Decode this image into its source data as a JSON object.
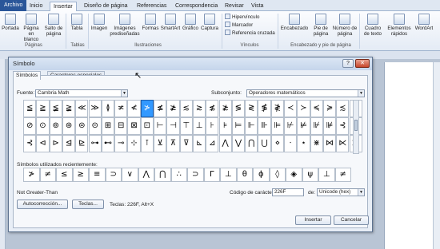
{
  "ribbon": {
    "tabs": [
      "Archivo",
      "Inicio",
      "Insertar",
      "Diseño de página",
      "Referencias",
      "Correspondencia",
      "Revisar",
      "Vista"
    ],
    "buttons": {
      "portada": "Portada",
      "pagina_en_blanco": "Página en blanco",
      "salto_de_pagina": "Salto de página",
      "tabla": "Tabla",
      "imagen": "Imagen",
      "imagenes_predisenadas": "Imágenes prediseñadas",
      "formas": "Formas",
      "smartart": "SmartArt",
      "grafico": "Gráfico",
      "captura": "Captura",
      "hipervinculo": "Hipervínculo",
      "marcador": "Marcador",
      "referencia_cruzada": "Referencia cruzada",
      "encabezado": "Encabezado",
      "pie_de_pagina": "Pie de página",
      "numero_de_pagina": "Número de página",
      "cuadro_de_texto": "Cuadro de texto",
      "elementos_rapidos": "Elementos rápidos",
      "wordart": "WordArt"
    },
    "groups": {
      "paginas": "Páginas",
      "tablas": "Tablas",
      "ilustraciones": "Ilustraciones",
      "vinculos": "Vínculos",
      "encabezado": "Encabezado y pie de página"
    }
  },
  "dialog": {
    "title": "Símbolo",
    "tabs": [
      "Símbolos",
      "Caracteres especiales"
    ],
    "font_label": "Fuente:",
    "font_value": "Cambria Math",
    "subset_label": "Subconjunto:",
    "subset_value": "Operadores matemáticos",
    "symbols": [
      [
        "≦",
        "≧",
        "≨",
        "≩",
        "≪",
        "≫",
        "≬",
        "≭",
        "≮",
        "≯",
        "≰",
        "≱",
        "≲",
        "≳",
        "≴",
        "≵",
        "≶",
        "≷",
        "≸",
        "≹",
        "≺",
        "≻",
        "≼",
        "≽",
        "≾",
        "≿"
      ],
      [
        "⊘",
        "⊙",
        "⊚",
        "⊛",
        "⊜",
        "⊝",
        "⊞",
        "⊟",
        "⊠",
        "⊡",
        "⊢",
        "⊣",
        "⊤",
        "⊥",
        "⊦",
        "⊧",
        "⊨",
        "⊩",
        "⊪",
        "⊫",
        "⊬",
        "⊭",
        "⊮",
        "⊯",
        "⊰",
        "⊱"
      ],
      [
        "⊰",
        "⊲",
        "⊳",
        "⊴",
        "⊵",
        "⊶",
        "⊷",
        "⊸",
        "⊹",
        "⊺",
        "⊻",
        "⊼",
        "⊽",
        "⊾",
        "⊿",
        "⋀",
        "⋁",
        "⋂",
        "⋃",
        "⋄",
        "⋅",
        "⋆",
        "⋇",
        "⋈",
        "⋉",
        "⋊"
      ]
    ],
    "selected": {
      "row": 0,
      "col": 9
    },
    "recent_label": "Símbolos utilizados recientemente:",
    "recent": [
      "≯",
      "≠",
      "≤",
      "≥",
      "≡",
      "⊃",
      "∨",
      "⋀",
      "⋂",
      "∴",
      "⊃",
      "Γ",
      "⊥",
      "θ",
      "ϕ",
      "◊",
      "◈",
      "ψ",
      "⊥",
      "≠"
    ],
    "char_name": "Not Greater-Than",
    "char_code_label": "Código de carácter:",
    "char_code": "226F",
    "from_label": "de:",
    "from_value": "Unicode (hex)",
    "autocorrect_button": "Autocorrección...",
    "keys_button": "Teclas...",
    "keys_text": "Teclas: 226F, Alt+X",
    "insert_button": "Insertar",
    "cancel_button": "Cancelar"
  }
}
